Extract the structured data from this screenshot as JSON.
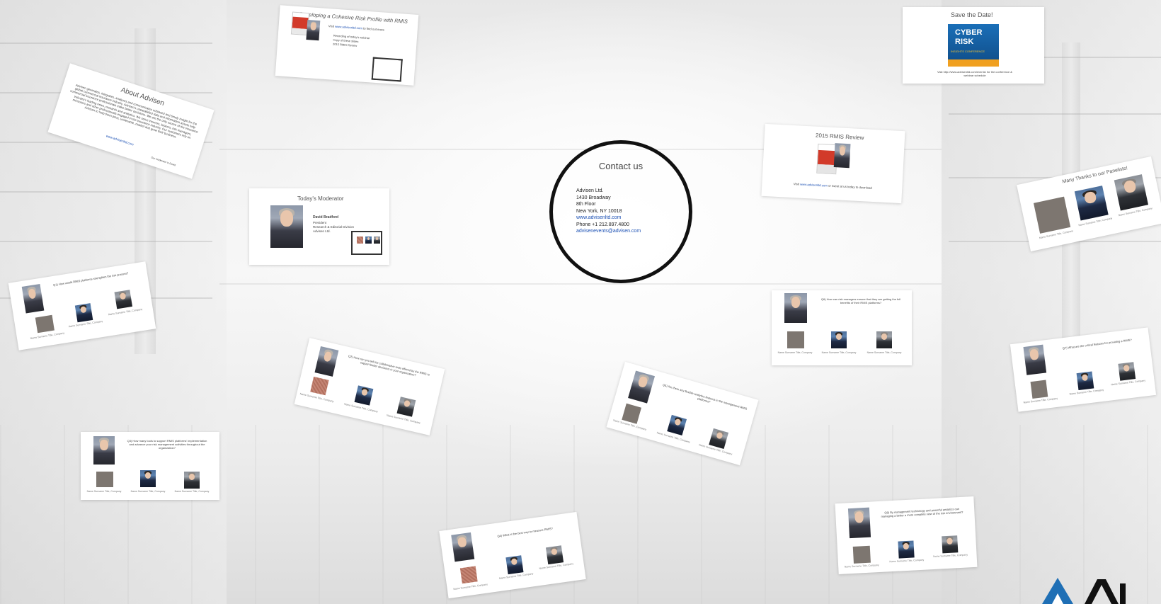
{
  "presentation": {
    "contact": {
      "title": "Contact us",
      "lines": [
        "Advisen Ltd.",
        "1430 Broadway",
        "8th Floor",
        "New York, NY 10018",
        "www.advisenltd.com",
        "Phone +1 212.897.4800",
        "advisenevents@advisen.com"
      ]
    },
    "about": {
      "title": "About Advisen",
      "body": "Advisen generates, integrates, analyzes and communicates unbiased and timely insight for the global commercial insurance industry. Advisen's unparalleled data and information assets help commercial insurance professionals make better decisions. We are the only source of the insurance industry's leading news, research and analytics. We serve insurers, brokers, risk managers, reinsurers and other professionals engaged in the insurance industry. Our customers rely on Advisen to help them price, underwrite, market and grow their business.",
      "link": "www.advisenltd.com",
      "note": "Our moderator is David"
    },
    "webinar": {
      "title": "Developing a Cohesive Risk Profile with RMIS",
      "visit_prefix": "Visit ",
      "link": "www.advisenltd.com",
      "visit_suffix": " to find out more",
      "bullets": [
        "Recording of today's webinar",
        "Copy of these slides",
        "2015 RMIS Review"
      ],
      "cover_year": "2015"
    },
    "save_date": {
      "title": "Save the Date!",
      "banner_line1": "CYBER",
      "banner_line2": "RISK",
      "banner_sub": "INSIGHTS CONFERENCE",
      "footer": "Visit http://www.advisenltd.com/events/ for the conference & webinar schedule"
    },
    "review": {
      "title": "2015 RMIS Review",
      "cover_year": "2015",
      "footer_prefix": "Visit ",
      "footer_link": "www.advisenltd.com",
      "footer_suffix": " or tweet at us today to download"
    },
    "moderator": {
      "title": "Today's Moderator",
      "name": "David Bradford",
      "role": "President",
      "dept": "Research & Editorial Division",
      "company": "Advisen Ltd."
    },
    "thanks": {
      "title": "Many Thanks to our Panelists!"
    },
    "questions": [
      "Q1) How would RMIS platforms strengthen the risk process?",
      "Q2) How can you tell the collaborative tools offered by the RMIS to support better decisions in your organization?",
      "Q3) How many tools to support RMIS platforms' implementation and advance your risk management activities throughout the organization?",
      "Q4) What is the best way to measure RMIS?",
      "Q5) Are there any flexible analytics features in the management RMIS platforms?",
      "Q6) How can risk managers ensure that they are getting the full benefits of their RMIS platforms?",
      "Q7) What are the critical features for providing a RMIS?",
      "Q8) By management technology and powerful analytics can managing a better a more complete view of the risk environment?"
    ],
    "panelist_caption": "Name Surname Title, Company"
  }
}
